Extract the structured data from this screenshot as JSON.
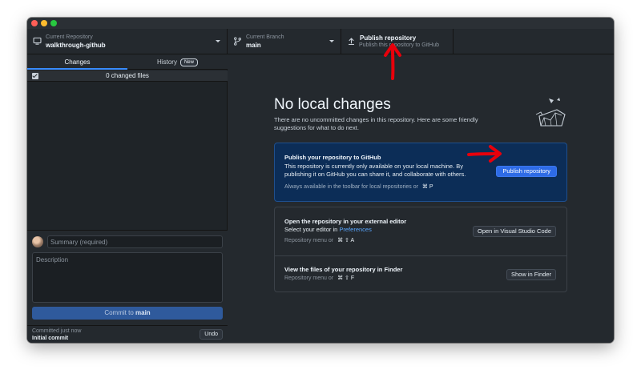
{
  "window": {
    "traffic_lights": [
      "close",
      "minimize",
      "zoom"
    ]
  },
  "toolbar": {
    "repository": {
      "label": "Current Repository",
      "value": "walkthrough-github",
      "icon": "monitor-icon"
    },
    "branch": {
      "label": "Current Branch",
      "value": "main",
      "icon": "git-branch-icon"
    },
    "publish": {
      "title": "Publish repository",
      "subtitle": "Publish this repository to GitHub",
      "icon": "upload-icon"
    }
  },
  "sidebar": {
    "tabs": [
      {
        "label": "Changes",
        "active": true
      },
      {
        "label": "History",
        "badge": "New"
      }
    ],
    "changes_summary": "0 changed files",
    "commit": {
      "summary_placeholder": "Summary (required)",
      "description_placeholder": "Description",
      "button_prefix": "Commit to",
      "button_branch": "main"
    },
    "last_commit": {
      "label": "Committed just now",
      "message": "Initial commit",
      "undo_label": "Undo"
    }
  },
  "main": {
    "heading": "No local changes",
    "intro": "There are no uncommitted changes in this repository. Here are some friendly suggestions for what to do next.",
    "publish_card": {
      "title": "Publish your repository to GitHub",
      "text": "This repository is currently only available on your local machine. By publishing it on GitHub you can share it, and collaborate with others.",
      "hint": "Always available in the toolbar for local repositories or",
      "shortcut": "⌘  P",
      "button": "Publish repository"
    },
    "editor_card": {
      "title": "Open the repository in your external editor",
      "text_prefix": "Select your editor in",
      "link": "Preferences",
      "hint": "Repository menu or",
      "shortcut": "⌘  ⇧  A",
      "button": "Open in Visual Studio Code"
    },
    "finder_card": {
      "title": "View the files of your repository in Finder",
      "hint": "Repository menu or",
      "shortcut": "⌘  ⇧  F",
      "button": "Show in Finder"
    }
  },
  "colors": {
    "accent": "#2e6be6",
    "annotation": "#e8000b",
    "background": "#24292e"
  }
}
